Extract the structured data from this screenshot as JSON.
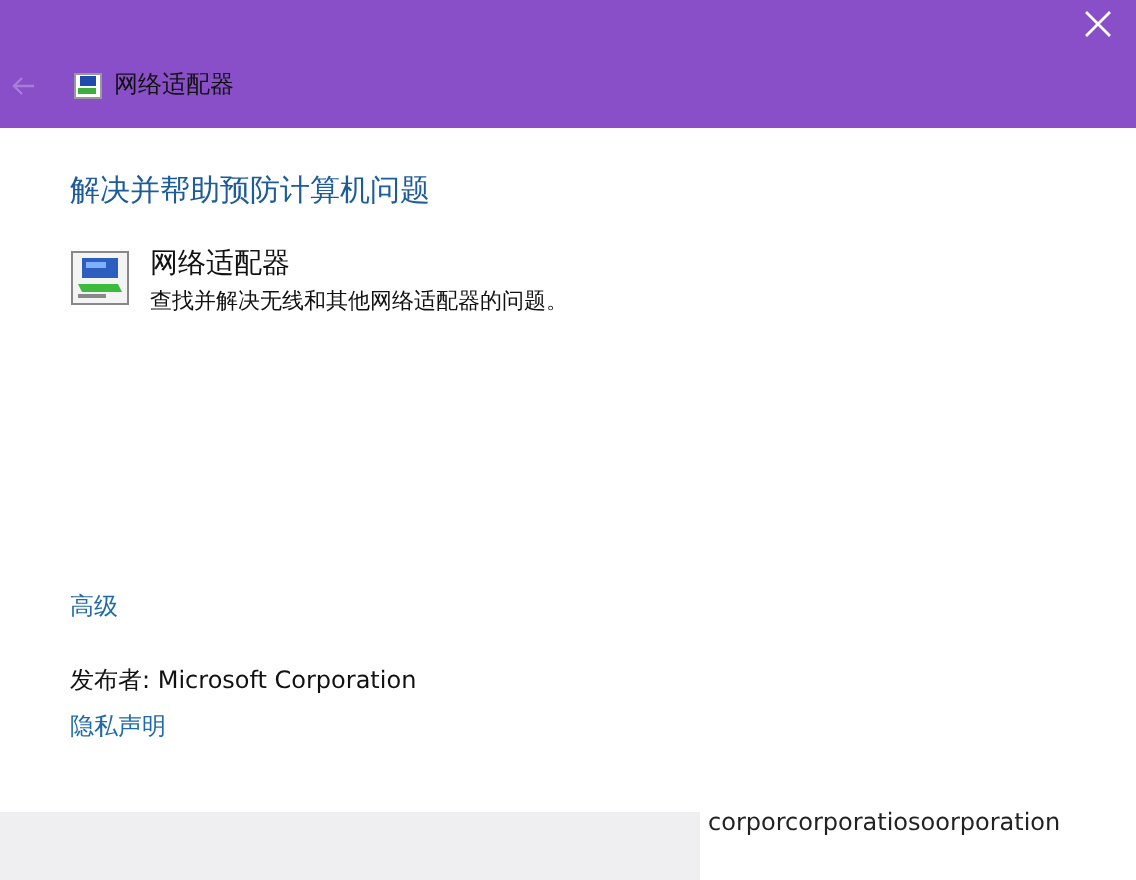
{
  "window": {
    "title": "网络适配器",
    "back_disabled": true
  },
  "heading": "解决并帮助预防计算机问题",
  "troubleshooter": {
    "name": "网络适配器",
    "description": "查找并解决无线和其他网络适配器的问题。"
  },
  "advanced_link": "高级",
  "publisher": "发布者:  Microsoft Corporation",
  "privacy_link": "隐私声明",
  "footer_text": "corporcorporatiosoorporation"
}
